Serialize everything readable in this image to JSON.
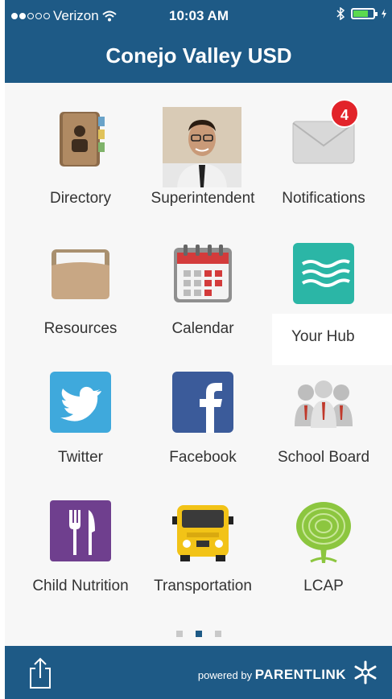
{
  "status_bar": {
    "carrier": "Verizon",
    "time": "10:03 AM"
  },
  "header": {
    "title": "Conejo Valley USD"
  },
  "tiles": [
    {
      "label": "Directory",
      "icon": "address-book-icon"
    },
    {
      "label": "Superintendent",
      "icon": "superintendent-photo"
    },
    {
      "label": "Notifications",
      "icon": "envelope-icon",
      "badge": "4"
    },
    {
      "label": "Resources",
      "icon": "folder-icon"
    },
    {
      "label": "Calendar",
      "icon": "calendar-icon"
    },
    {
      "label": "Your Hub",
      "icon": "waves-icon"
    },
    {
      "label": "Twitter",
      "icon": "twitter-icon"
    },
    {
      "label": "Facebook",
      "icon": "facebook-icon"
    },
    {
      "label": "School Board",
      "icon": "people-icon"
    },
    {
      "label": "Child Nutrition",
      "icon": "fork-knife-icon"
    },
    {
      "label": "Transportation",
      "icon": "bus-icon"
    },
    {
      "label": "LCAP",
      "icon": "fingerprint-tree-icon"
    }
  ],
  "pager": {
    "pages": 3,
    "active": 2
  },
  "footer": {
    "powered_by": "powered by",
    "brand": "PARENTLINK"
  },
  "colors": {
    "brand": "#1e5a86",
    "badge": "#e2232a"
  }
}
